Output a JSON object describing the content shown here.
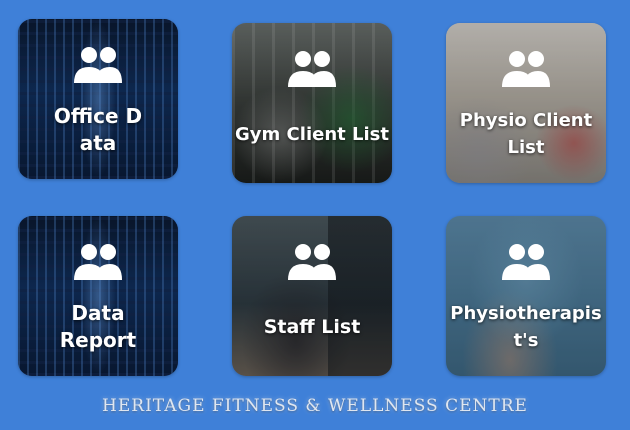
{
  "tiles": [
    {
      "label": "Office Data",
      "icon": "users-icon"
    },
    {
      "label": "Gym Client List",
      "icon": "users-icon"
    },
    {
      "label": "Physio Client List",
      "icon": "users-icon"
    },
    {
      "label": "Data Report",
      "icon": "users-icon"
    },
    {
      "label": "Staff List",
      "icon": "users-icon"
    },
    {
      "label": "Physiotherapist's",
      "icon": "users-icon"
    }
  ],
  "footer": {
    "title": "HERITAGE FITNESS & WELLNESS CENTRE"
  },
  "colors": {
    "background": "#3f80d8",
    "tile_text": "#ffffff"
  }
}
